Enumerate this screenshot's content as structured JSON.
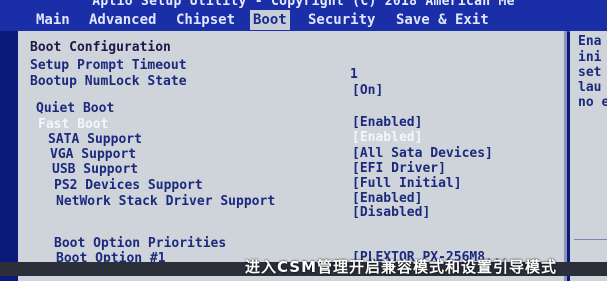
{
  "window": {
    "title": "Aptio Setup Utility - Copyright (C) 2018 American Me"
  },
  "tabs": [
    {
      "label": "Main"
    },
    {
      "label": "Advanced"
    },
    {
      "label": "Chipset"
    },
    {
      "label": "Boot"
    },
    {
      "label": "Security"
    },
    {
      "label": "Save & Exit"
    }
  ],
  "content": {
    "boot_configuration_heading": "Boot Configuration",
    "setup_prompt_timeout": {
      "label": "Setup Prompt Timeout",
      "value": "1"
    },
    "bootup_numlock_state": {
      "label": "Bootup NumLock State",
      "value": "[On]"
    },
    "quiet_boot": {
      "label": "Quiet Boot",
      "value": "[Enabled]"
    },
    "fast_boot": {
      "label": "Fast Boot",
      "value": "[Enabled]"
    },
    "sata_support": {
      "label": "SATA Support",
      "value": "[All Sata Devices]"
    },
    "vga_support": {
      "label": "VGA Support",
      "value": "[EFI Driver]"
    },
    "usb_support": {
      "label": "USB Support",
      "value": "[Full Initial]"
    },
    "ps2_devices_support": {
      "label": "PS2 Devices Support",
      "value": "[Enabled]"
    },
    "network_stack_support": {
      "label": "NetWork Stack Driver Support",
      "value": "[Disabled]"
    },
    "boot_option_priorities_heading": "Boot Option Priorities",
    "boot_option_1": {
      "label": "Boot Option #1",
      "value": "[PLEXTOR PX-256M8..."
    }
  },
  "help_panel": {
    "lines": [
      "Ena",
      "ini",
      "set",
      "lau",
      "no e"
    ]
  },
  "caption": "进入CSM管理开启兼容模式和设置引导模式"
}
